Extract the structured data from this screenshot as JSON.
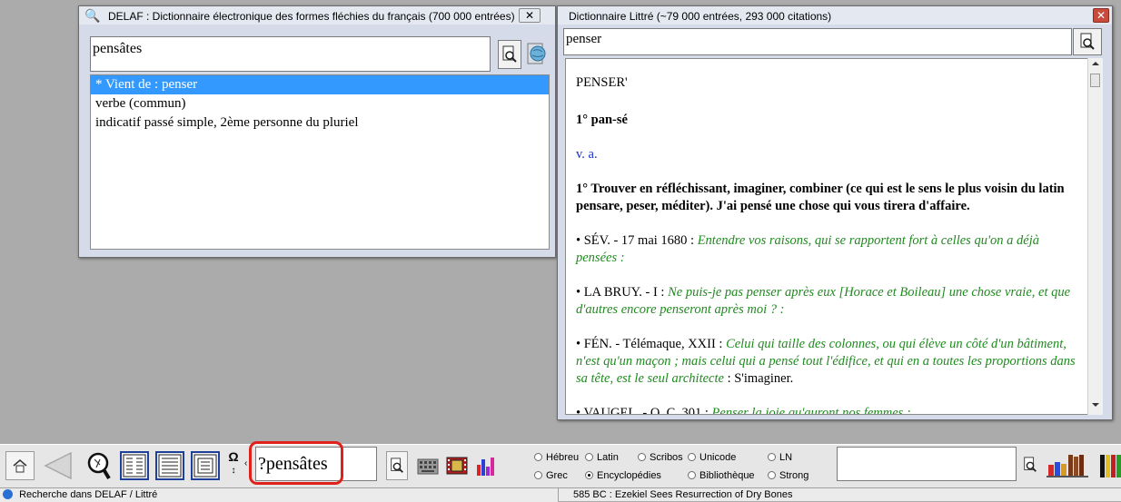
{
  "delaf_window": {
    "title": "DELAF : Dictionnaire électronique des formes fléchies du français (700 000 entrées)",
    "search_value": "pensâtes",
    "results": [
      "* Vient de : penser",
      "verbe (commun)",
      "indicatif passé simple, 2ème personne du pluriel"
    ],
    "close_label": "✕"
  },
  "littre_window": {
    "title": "Dictionnaire Littré (~79 000 entrées, 293 000 citations)",
    "search_value": "penser",
    "close_label": "✕",
    "entry": {
      "headword": "PENSER'",
      "pronunciation": "1° pan-sé",
      "pos": "v. a.",
      "sense1": "1° Trouver en réfléchissant, imaginer, combiner (ce qui est le sens le plus voisin du latin pensare, peser, méditer). J'ai pensé une chose qui vous tirera d'affaire.",
      "citations": [
        {
          "source": "• SÉV. - 17 mai 1680 : ",
          "text": "Entendre vos raisons, qui se rapportent fort à celles qu'on a déjà pensées :",
          "tail": ""
        },
        {
          "source": "• LA BRUY. - I : ",
          "text": "Ne puis-je pas penser après eux [Horace et Boileau] une chose vraie, et que d'autres encore penseront après moi ? :",
          "tail": ""
        },
        {
          "source": "• FÉN. - Télémaque, XXII : ",
          "text": "Celui qui taille des colonnes, ou qui élève un côté d'un bâtiment, n'est qu'un maçon ; mais celui qui a pensé tout l'édifice, et qui en a toutes les proportions dans sa tête, est le seul architecte",
          "tail": " : S'imaginer."
        },
        {
          "source": "• VAUGEL. - Q. C. 301 : ",
          "text": "Penser la joie qu'auront nos femmes :",
          "tail": ""
        }
      ]
    }
  },
  "toolbar": {
    "omega_label": "Ω",
    "search_value": "?pensâtes",
    "radios": [
      {
        "label": "Hébreu",
        "checked": false
      },
      {
        "label": "Latin",
        "checked": false
      },
      {
        "label": "Scribos",
        "checked": false
      },
      {
        "label": "Unicode",
        "checked": false
      },
      {
        "label": "LN",
        "checked": false
      },
      {
        "label": "Grec",
        "checked": false
      },
      {
        "label": "Encyclopédies",
        "checked": true
      },
      {
        "label": "Bibliothèque",
        "checked": false
      },
      {
        "label": "Strong",
        "checked": false
      }
    ],
    "right_search_value": "",
    "highlight_color": "#e0201a"
  },
  "status": {
    "left": "Recherche dans DELAF / Littré",
    "right": "585 BC : Ezekiel Sees Resurrection of Dry Bones"
  }
}
